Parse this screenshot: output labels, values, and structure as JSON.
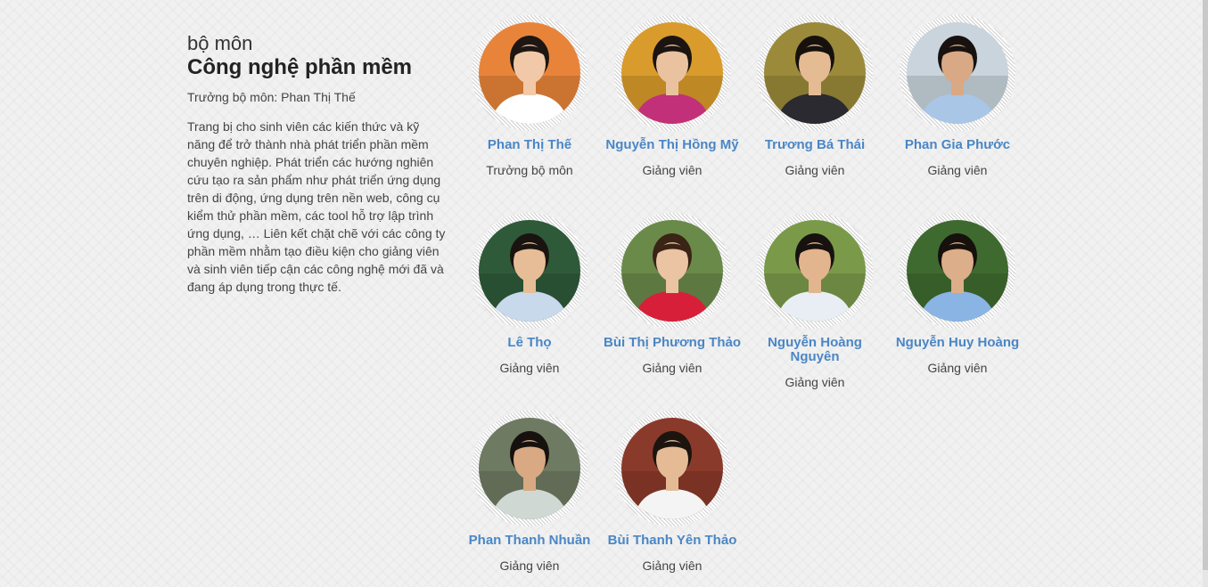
{
  "department": {
    "kicker": "bộ môn",
    "title": "Công nghệ phần mềm",
    "head_line": "Trưởng bộ môn: Phan Thị Thế",
    "description": "Trang bị cho sinh viên các kiến thức và kỹ năng để trở thành nhà phát triển phần mềm chuyên nghiệp. Phát triển các hướng nghiên cứu tạo ra sản phẩm như phát triển ứng dụng trên di động, ứng dụng trên nền web, công cụ kiểm thử phần mềm, các tool hỗ trợ lập trình ứng dụng, … Liên kết chặt chẽ với các công ty phần mềm nhằm tạo điều kiện cho giảng viên và sinh viên tiếp cận các công nghệ mới đã và đang áp dụng trong thực tế."
  },
  "members": [
    {
      "name": "Phan Thị Thế",
      "role": "Trưởng bộ môn",
      "bg": "#e8843a",
      "skin": "#f2c9a8",
      "hair": "#1e1612",
      "shirt": "#ffffff"
    },
    {
      "name": "Nguyễn Thị Hồng Mỹ",
      "role": "Giảng viên",
      "bg": "#d99b2b",
      "skin": "#eac2a0",
      "hair": "#1b1410",
      "shirt": "#c2307a"
    },
    {
      "name": "Trương Bá Thái",
      "role": "Giảng viên",
      "bg": "#9a8a3a",
      "skin": "#e5bb94",
      "hair": "#16110d",
      "shirt": "#2a2a30"
    },
    {
      "name": "Phan Gia Phước",
      "role": "Giảng viên",
      "bg": "#c9d4dc",
      "skin": "#d9a985",
      "hair": "#17120f",
      "shirt": "#a9c6e6"
    },
    {
      "name": "Lê Thọ",
      "role": "Giảng viên",
      "bg": "#2f5a3a",
      "skin": "#e7bd97",
      "hair": "#1a1410",
      "shirt": "#c9d9ec"
    },
    {
      "name": "Bùi Thị Phương Thảo",
      "role": "Giảng viên",
      "bg": "#6a8a4a",
      "skin": "#eac4a3",
      "hair": "#3a2416",
      "shirt": "#d81f3a"
    },
    {
      "name": "Nguyễn Hoàng Nguyên",
      "role": "Giảng viên",
      "bg": "#7a9a4a",
      "skin": "#e3b58e",
      "hair": "#17120f",
      "shirt": "#e9eef4"
    },
    {
      "name": "Nguyễn Huy Hoàng",
      "role": "Giảng viên",
      "bg": "#3f6a2f",
      "skin": "#dcae89",
      "hair": "#16110d",
      "shirt": "#8ab4e4"
    },
    {
      "name": "Phan Thanh Nhuần",
      "role": "Giảng viên",
      "bg": "#6f7a62",
      "skin": "#d9a983",
      "hair": "#15110e",
      "shirt": "#cfd8d2"
    },
    {
      "name": "Bùi Thanh Yên Thảo",
      "role": "Giảng viên",
      "bg": "#8a3a2a",
      "skin": "#e5bb95",
      "hair": "#1c140f",
      "shirt": "#f4f4f4"
    }
  ]
}
